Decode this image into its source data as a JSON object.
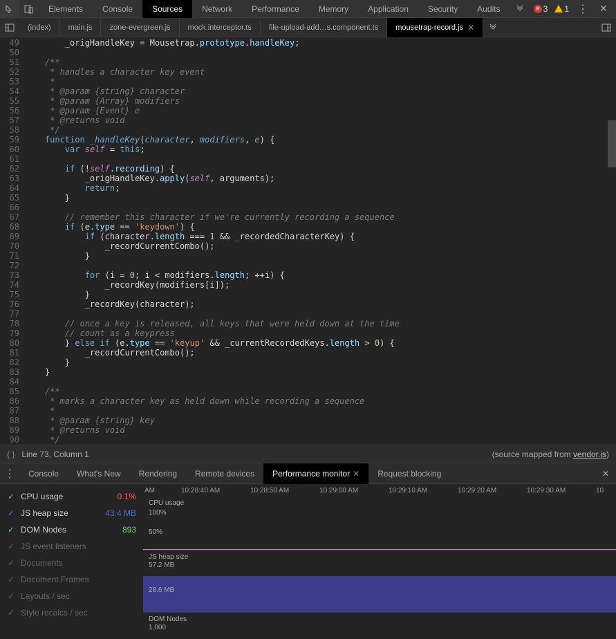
{
  "topbar": {
    "tabs": [
      "Elements",
      "Console",
      "Sources",
      "Network",
      "Performance",
      "Memory",
      "Application",
      "Security",
      "Audits"
    ],
    "active": 2,
    "errors": "3",
    "warnings": "1"
  },
  "file_tabs": {
    "items": [
      "(index)",
      "main.js",
      "zone-evergreen.js",
      "mock.interceptor.ts",
      "file-upload-add…s.component.ts",
      "mousetrap-record.js"
    ],
    "active": 5
  },
  "code": {
    "start_line": 49,
    "end_line": 90
  },
  "status": {
    "cursor": "Line 73, Column 1",
    "mapped_prefix": "(source mapped from ",
    "mapped_file": "vendor.js",
    "mapped_suffix": ")"
  },
  "drawer": {
    "tabs": [
      "Console",
      "What's New",
      "Rendering",
      "Remote devices",
      "Performance monitor",
      "Request blocking"
    ],
    "active": 4
  },
  "metrics": [
    {
      "label": "CPU usage",
      "value": "0.1%",
      "on": true,
      "color": "red"
    },
    {
      "label": "JS heap size",
      "value": "43.4 MB",
      "on": true,
      "color": "blue"
    },
    {
      "label": "DOM Nodes",
      "value": "893",
      "on": true,
      "color": "green"
    },
    {
      "label": "JS event listeners",
      "value": "",
      "on": false
    },
    {
      "label": "Documents",
      "value": "",
      "on": false
    },
    {
      "label": "Document Frames",
      "value": "",
      "on": false
    },
    {
      "label": "Layouts / sec",
      "value": "",
      "on": false
    },
    {
      "label": "Style recalcs / sec",
      "value": "",
      "on": false
    }
  ],
  "timestamps": [
    "AM",
    "10:28:40 AM",
    "10:28:50 AM",
    "10:29:00 AM",
    "10:29:10 AM",
    "10:29:20 AM",
    "10:29:30 AM",
    "10"
  ],
  "chart_data": [
    {
      "type": "line",
      "title": "CPU usage",
      "ylabel": "",
      "yticks": [
        "100%",
        "50%"
      ],
      "ylim": [
        0,
        100
      ],
      "series": [
        {
          "name": "CPU usage",
          "values_pct": 0.1,
          "color": "#d97eb8"
        }
      ]
    },
    {
      "type": "area",
      "title": "JS heap size",
      "ylabel_top": "57.2 MB",
      "ylabel_mid": "28.6 MB",
      "ylim": [
        0,
        57.2
      ],
      "current": 43.4,
      "series": [
        {
          "name": "JS heap size",
          "approx_fill_mb": 43.4,
          "color": "#3b3d8c"
        }
      ]
    },
    {
      "type": "line",
      "title": "DOM Nodes",
      "yticks": [
        "1,000"
      ],
      "current": 893,
      "series": [
        {
          "name": "DOM Nodes",
          "color": "#7ec27e"
        }
      ]
    }
  ]
}
